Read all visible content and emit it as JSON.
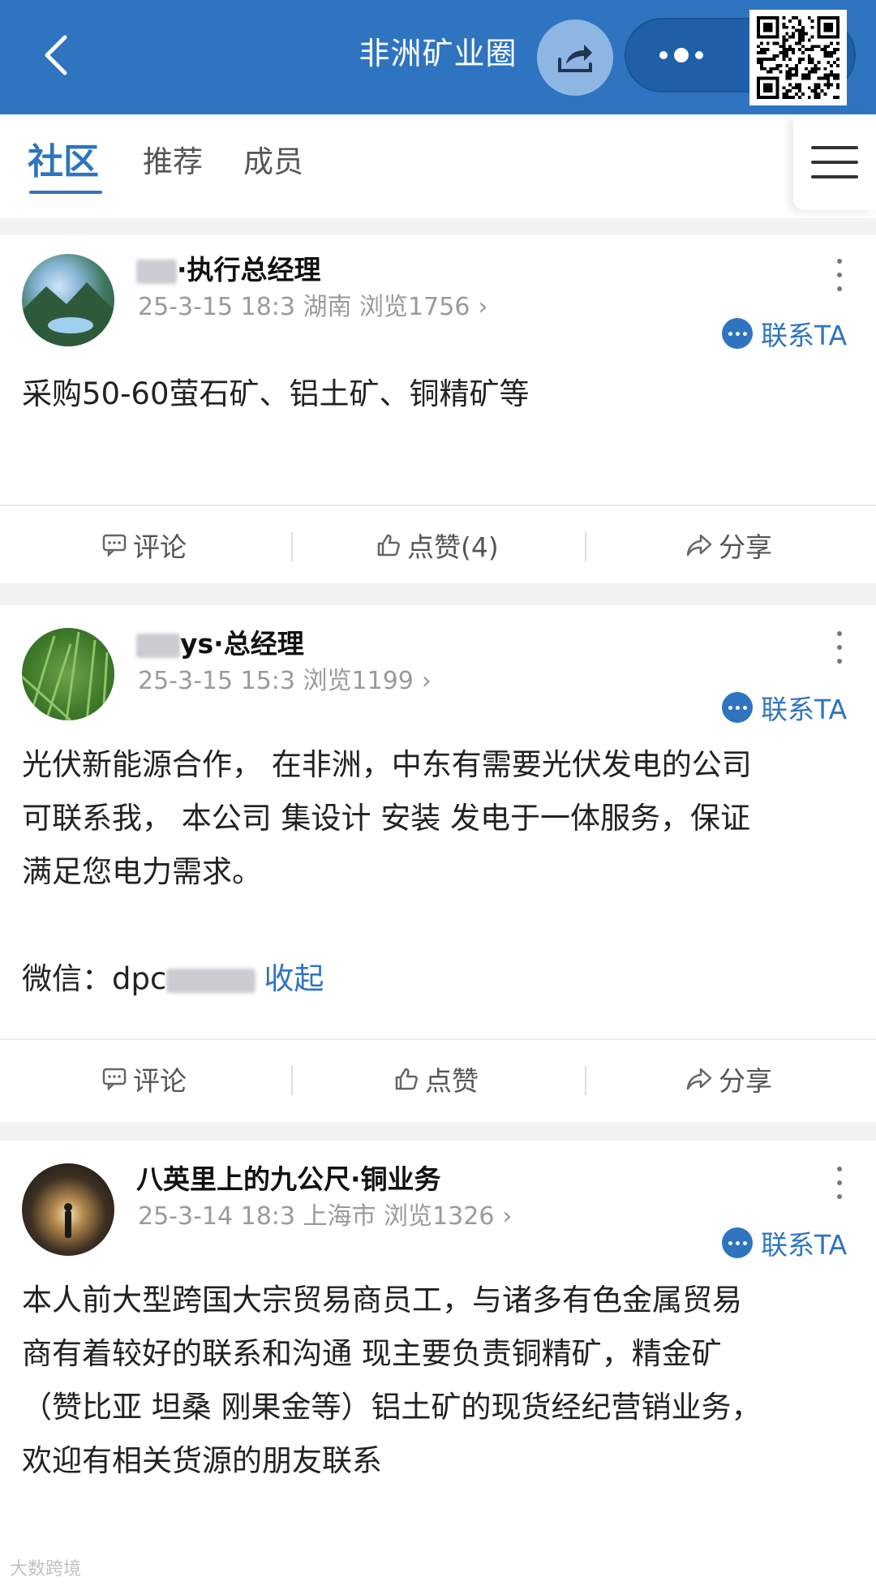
{
  "header": {
    "title": "非洲矿业圈",
    "back_icon": "chevron-left-icon",
    "share_icon": "share-icon",
    "more_icon": "more-dots-icon",
    "qr_icon": "qr-code-icon"
  },
  "tabs": [
    "社区",
    "推荐",
    "成员"
  ],
  "posts": [
    {
      "author_name": "·执行总经理",
      "meta": "25-3-15 18:3 湖南 浏览1756",
      "contact": "联系TA",
      "content": [
        "采购50-60萤石矿、铝土矿、铜精矿等"
      ],
      "comment": "评论",
      "like": "点赞(4)",
      "share": "分享"
    },
    {
      "author_name": "ys·总经理",
      "meta": "25-3-15 15:3 浏览1199",
      "contact": "联系TA",
      "content": [
        "光伏新能源合作， 在非洲，中东有需要光伏发电的公司",
        "可联系我， 本公司 集设计 安装 发电于一体服务，保证",
        "满足您电力需求。"
      ],
      "wechat_prefix": "微信：dpc",
      "collapse": "收起",
      "comment": "评论",
      "like": "点赞",
      "share": "分享"
    },
    {
      "author_name": "八英里上的九公尺·铜业务",
      "meta": "25-3-14 18:3 上海市 浏览1326",
      "contact": "联系TA",
      "content": [
        "本人前大型跨国大宗贸易商员工，与诸多有色金属贸易",
        "商有着较好的联系和沟通 现主要负责铜精矿，精金矿",
        "（赞比亚 坦桑 刚果金等）铝土矿的现货经纪营销业务，",
        "欢迎有相关货源的朋友联系"
      ]
    }
  ],
  "watermark": "大数跨境",
  "colors": {
    "brand": "#2f74c0",
    "header_bg": "#2f74c0"
  }
}
